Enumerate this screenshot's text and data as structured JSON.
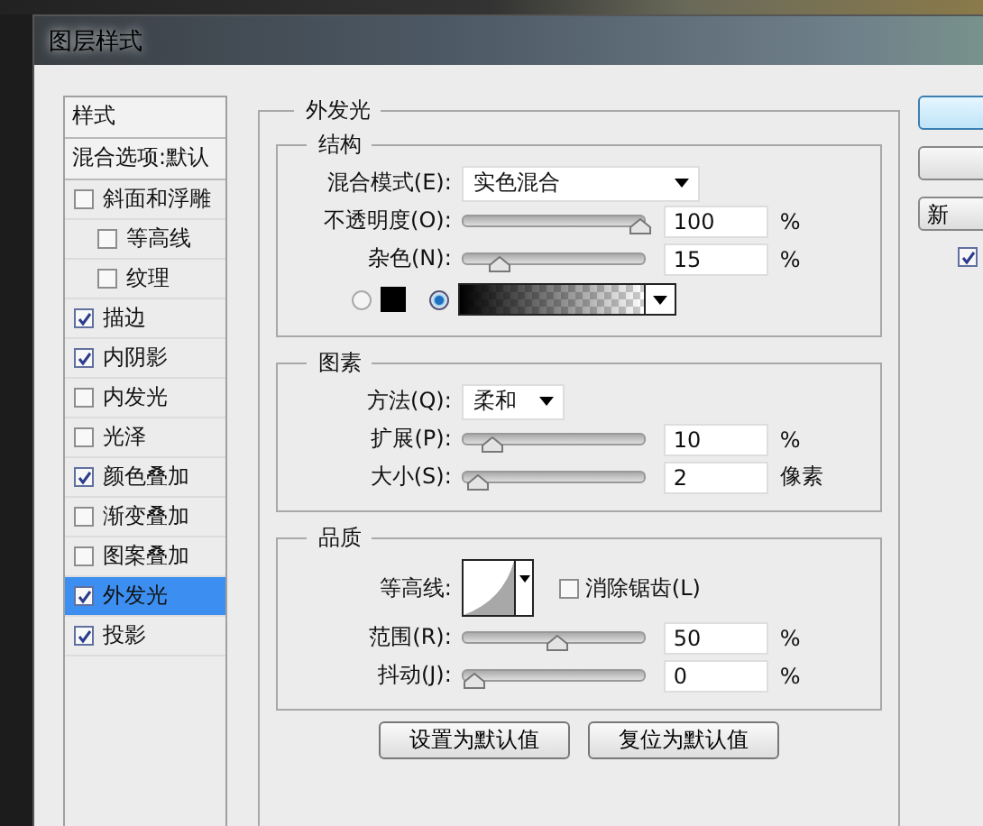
{
  "window": {
    "title": "图层样式"
  },
  "styles_panel": {
    "header": "样式",
    "blend_options": "混合选项:默认",
    "items": [
      {
        "label": "斜面和浮雕",
        "checked": false,
        "selected": false,
        "children": [
          {
            "label": "等高线",
            "checked": false,
            "selected": false
          },
          {
            "label": "纹理",
            "checked": false,
            "selected": false
          }
        ]
      },
      {
        "label": "描边",
        "checked": true,
        "selected": false
      },
      {
        "label": "内阴影",
        "checked": true,
        "selected": false
      },
      {
        "label": "内发光",
        "checked": false,
        "selected": false
      },
      {
        "label": "光泽",
        "checked": false,
        "selected": false
      },
      {
        "label": "颜色叠加",
        "checked": true,
        "selected": false
      },
      {
        "label": "渐变叠加",
        "checked": false,
        "selected": false
      },
      {
        "label": "图案叠加",
        "checked": false,
        "selected": false
      },
      {
        "label": "外发光",
        "checked": true,
        "selected": true
      },
      {
        "label": "投影",
        "checked": true,
        "selected": false
      }
    ]
  },
  "outer_glow": {
    "title": "外发光",
    "structure": {
      "title": "结构",
      "blend_mode": {
        "label": "混合模式(E):",
        "value": "实色混合"
      },
      "sliders": [
        {
          "label": "不透明度(O):",
          "level": 1,
          "value": "100",
          "unit": "%"
        },
        {
          "label": "杂色(N):",
          "level": 0.15,
          "value": "15",
          "unit": "%"
        }
      ],
      "fill_options": [
        {
          "kind": "color",
          "selected": false
        },
        {
          "kind": "gradient",
          "selected": true
        }
      ]
    },
    "elements": {
      "title": "图素",
      "technique": {
        "label": "方法(Q):",
        "value": "柔和"
      },
      "sliders": [
        {
          "label": "扩展(P):",
          "level": 0.1,
          "value": "10",
          "unit": "%"
        },
        {
          "label": "大小(S):",
          "level": 0.02,
          "value": "2",
          "unit": "像素"
        }
      ]
    },
    "quality": {
      "title": "品质",
      "contour_label": "等高线:",
      "anti_alias": {
        "label": "消除锯齿(L)",
        "checked": false
      },
      "sliders": [
        {
          "label": "范围(R):",
          "level": 0.5,
          "value": "50",
          "unit": "%"
        },
        {
          "label": "抖动(J):",
          "level": 0,
          "value": "0",
          "unit": "%"
        }
      ]
    },
    "buttons": [
      "设置为默认值",
      "复位为默认值"
    ]
  },
  "right_panel": {
    "new_style_button": "新",
    "preview_checked": true
  }
}
